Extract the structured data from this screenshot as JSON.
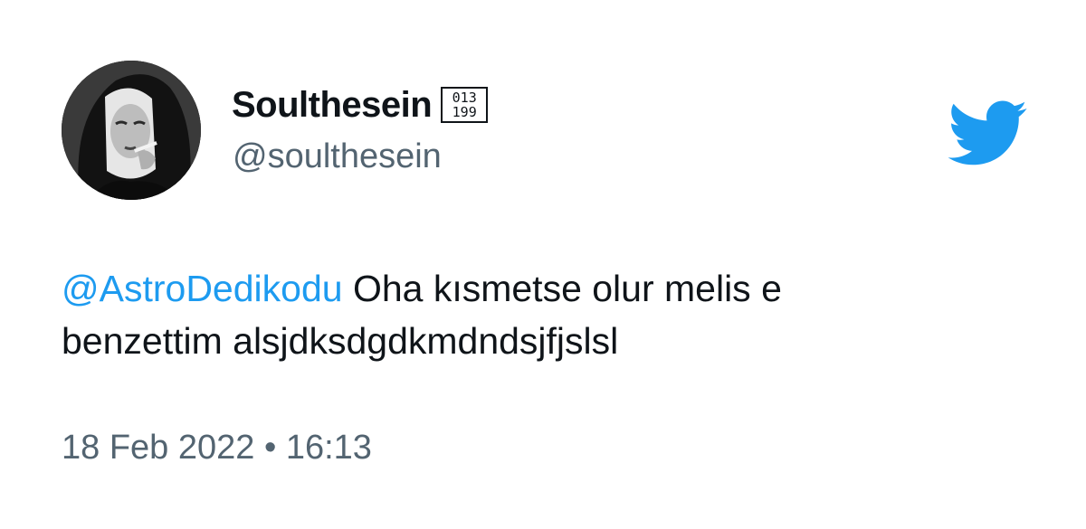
{
  "author": {
    "display_name": "Soulthesein",
    "name_glyph": {
      "top": "013",
      "bottom": "199"
    },
    "handle": "@soulthesein",
    "avatar_icon": "profile-photo"
  },
  "tweet": {
    "mention": "@AstroDedikodu",
    "body_line1": " Oha kısmetse olur melis e",
    "body_line2": "benzettim alsjdksdgdkmdndsjfjslsl"
  },
  "meta": {
    "date": "18 Feb 2022",
    "separator": "•",
    "time": "16:13"
  },
  "brand": {
    "logo_icon": "twitter-bird-icon",
    "accent_color": "#1d9bf0",
    "secondary_text_color": "#536471"
  }
}
